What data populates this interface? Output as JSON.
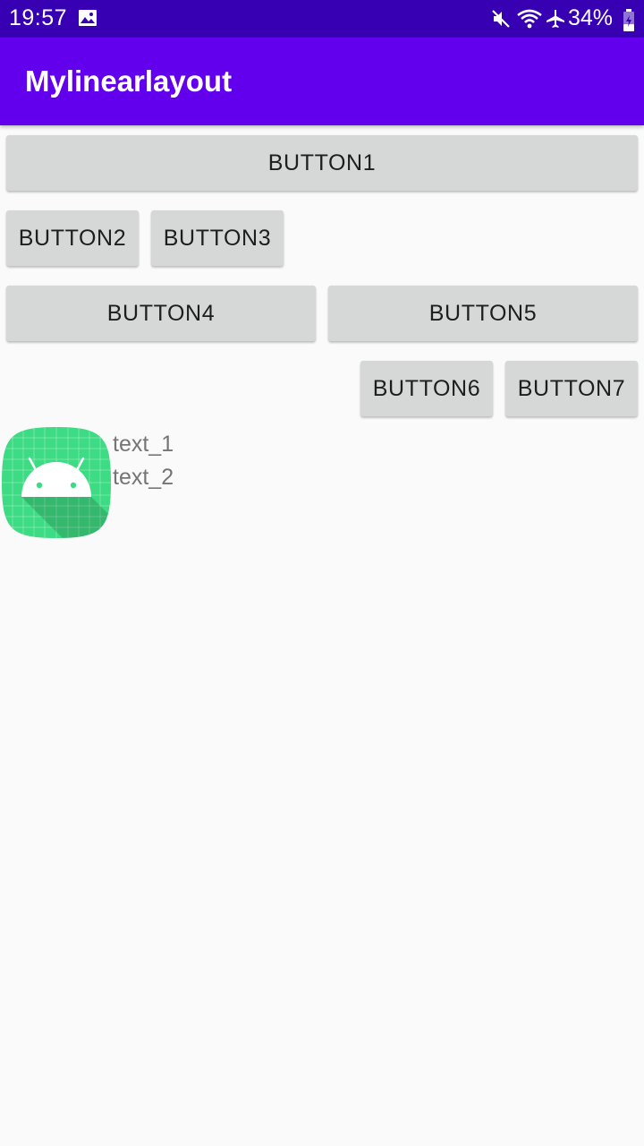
{
  "status_bar": {
    "time": "19:57",
    "battery": "34%",
    "icons": [
      "gallery-icon",
      "mute-icon",
      "wifi-icon",
      "airplane-icon",
      "battery-icon"
    ]
  },
  "app_bar": {
    "title": "Mylinearlayout",
    "color": "#6200ee"
  },
  "buttons": {
    "button1": "BUTTON1",
    "button2": "BUTTON2",
    "button3": "BUTTON3",
    "button4": "BUTTON4",
    "button5": "BUTTON5",
    "button6": "BUTTON6",
    "button7": "BUTTON7"
  },
  "content": {
    "icon": "android-launcher-icon",
    "text_1": "text_1",
    "text_2": "text_2"
  },
  "colors": {
    "status_bar": "#3700b3",
    "primary": "#6200ee",
    "button_bg": "#d6d7d7",
    "background": "#fafafa",
    "icon_green": "#3ddc84"
  }
}
